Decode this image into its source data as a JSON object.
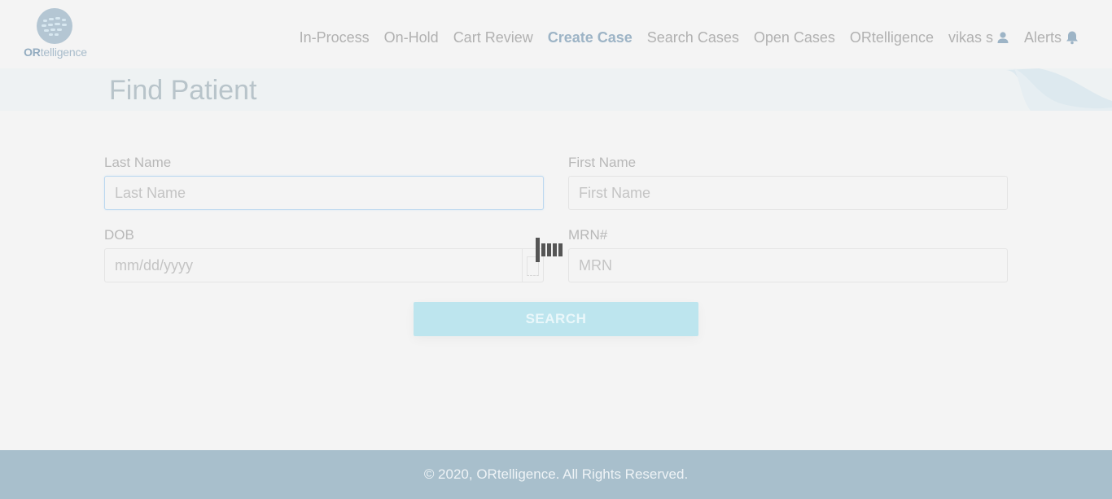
{
  "brand": {
    "logo_text_bold": "OR",
    "logo_text_rest": "telligence"
  },
  "nav": {
    "items": [
      {
        "label": "In-Process"
      },
      {
        "label": "On-Hold"
      },
      {
        "label": "Cart Review"
      },
      {
        "label": "Create Case",
        "active": true
      },
      {
        "label": "Search Cases"
      },
      {
        "label": "Open Cases"
      },
      {
        "label": "ORtelligence"
      },
      {
        "label": "vikas s",
        "icon": "user-icon"
      },
      {
        "label": "Alerts",
        "icon": "bell-icon"
      }
    ]
  },
  "page": {
    "title": "Find Patient"
  },
  "form": {
    "last_name": {
      "label": "Last Name",
      "placeholder": "Last Name",
      "value": ""
    },
    "first_name": {
      "label": "First Name",
      "placeholder": "First Name",
      "value": ""
    },
    "dob": {
      "label": "DOB",
      "placeholder": "mm/dd/yyyy",
      "value": "",
      "icon": "calendar-icon"
    },
    "mrn": {
      "label": "MRN#",
      "placeholder": "MRN",
      "value": ""
    },
    "search_label": "SEARCH"
  },
  "footer": {
    "text": "© 2020, ORtelligence. All Rights Reserved."
  },
  "colors": {
    "accent": "#9db4c6",
    "button": "#bde5ee",
    "footer": "#a8bfcc",
    "background": "#f4f4f4"
  }
}
